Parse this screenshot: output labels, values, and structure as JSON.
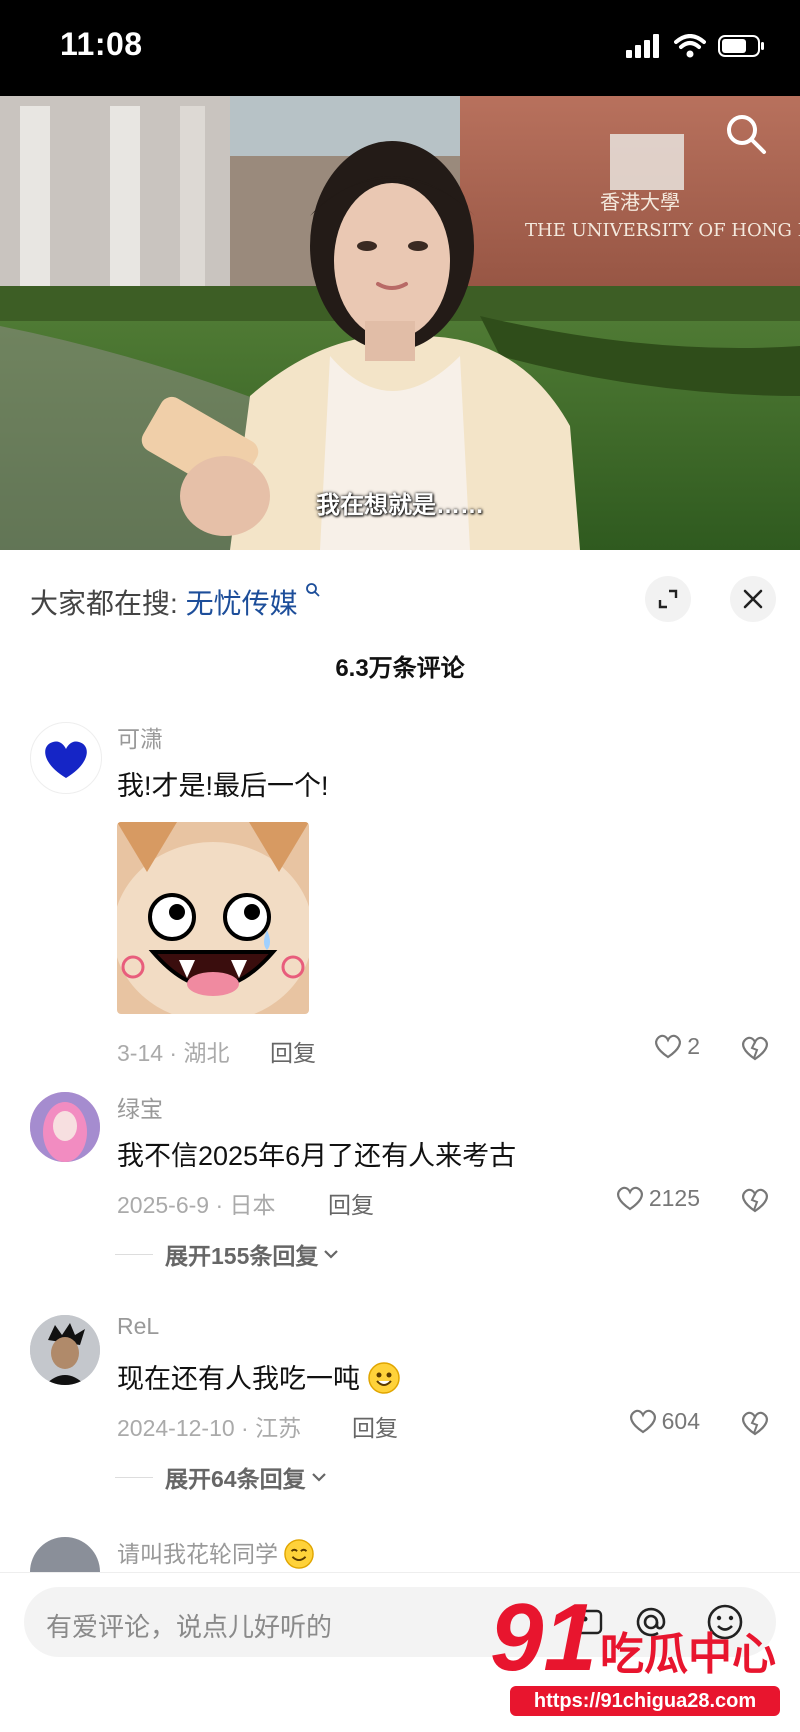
{
  "status": {
    "time": "11:08"
  },
  "video": {
    "subtitle": "我在想就是……",
    "sign_cn": "香港大學",
    "sign_en": "THE UNIVERSITY OF HONG K"
  },
  "sheet": {
    "hot_search_prefix": "大家都在搜:",
    "hot_search_term": "无忧传媒",
    "comment_count": "6.3万条评论"
  },
  "comments": [
    {
      "name": "可潇",
      "text": "我!才是!最后一个!",
      "meta": "3-14 · 湖北",
      "reply": "回复",
      "likes": "2"
    },
    {
      "name": "绿宝",
      "text": "我不信2025年6月了还有人来考古",
      "meta": "2025-6-9 · 日本",
      "reply": "回复",
      "likes": "2125",
      "expand": "展开155条回复"
    },
    {
      "name": "ReL",
      "text": "现在还有人我吃一吨",
      "meta": "2024-12-10 · 江苏",
      "reply": "回复",
      "likes": "604",
      "expand": "展开64条回复"
    },
    {
      "name": "请叫我花轮同学"
    }
  ],
  "input": {
    "placeholder": "有爱评论，说点儿好听的"
  },
  "watermark": {
    "brand_num": "91",
    "brand_text": "吃瓜中心",
    "url": "https://91chigua28.com"
  }
}
